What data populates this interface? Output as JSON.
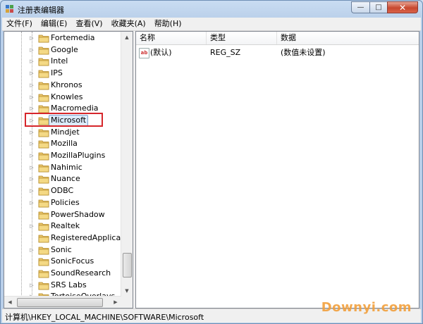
{
  "window": {
    "title": "注册表编辑器",
    "controls": {
      "minimize": "—",
      "maximize": "□",
      "close": "✕"
    }
  },
  "menu": [
    "文件(F)",
    "编辑(E)",
    "查看(V)",
    "收藏夹(A)",
    "帮助(H)"
  ],
  "tree": {
    "items": [
      {
        "label": "Fortemedia",
        "expandable": true
      },
      {
        "label": "Google",
        "expandable": true
      },
      {
        "label": "Intel",
        "expandable": true
      },
      {
        "label": "IPS",
        "expandable": true
      },
      {
        "label": "Khronos",
        "expandable": true
      },
      {
        "label": "Knowles",
        "expandable": true
      },
      {
        "label": "Macromedia",
        "expandable": true
      },
      {
        "label": "Microsoft",
        "expandable": true,
        "selected": true
      },
      {
        "label": "Mindjet",
        "expandable": true
      },
      {
        "label": "Mozilla",
        "expandable": true
      },
      {
        "label": "MozillaPlugins",
        "expandable": true
      },
      {
        "label": "Nahimic",
        "expandable": true
      },
      {
        "label": "Nuance",
        "expandable": true
      },
      {
        "label": "ODBC",
        "expandable": true
      },
      {
        "label": "Policies",
        "expandable": true
      },
      {
        "label": "PowerShadow",
        "expandable": false
      },
      {
        "label": "Realtek",
        "expandable": true
      },
      {
        "label": "RegisteredApplicatio",
        "expandable": false
      },
      {
        "label": "Sonic",
        "expandable": true
      },
      {
        "label": "SonicFocus",
        "expandable": false
      },
      {
        "label": "SoundResearch",
        "expandable": false
      },
      {
        "label": "SRS Labs",
        "expandable": true
      },
      {
        "label": "TortoiseOverlays",
        "expandable": true
      }
    ]
  },
  "list": {
    "columns": [
      "名称",
      "类型",
      "数据"
    ],
    "rows": [
      {
        "icon": "ab",
        "name": "(默认)",
        "type": "REG_SZ",
        "data": "(数值未设置)"
      }
    ]
  },
  "status": {
    "path": "计算机\\HKEY_LOCAL_MACHINE\\SOFTWARE\\Microsoft"
  },
  "watermark": "Downyi.com",
  "colors": {
    "highlight_box": "#d6262b",
    "selection": "#dcebfc",
    "watermark": "#f2a03d"
  }
}
